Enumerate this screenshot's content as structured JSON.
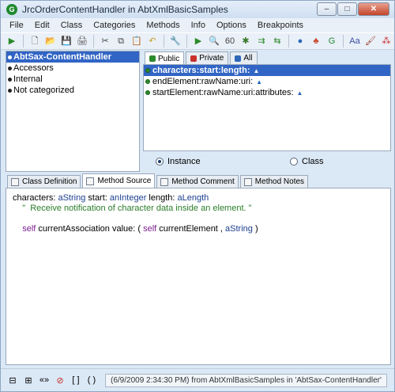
{
  "window": {
    "title": "JrcOrderContentHandler in AbtXmlBasicSamples",
    "app_icon_glyph": "G",
    "min_glyph": "–",
    "max_glyph": "□",
    "close_glyph": "✕"
  },
  "menu": [
    "File",
    "Edit",
    "Class",
    "Categories",
    "Methods",
    "Info",
    "Options",
    "Breakpoints"
  ],
  "toolbar": {
    "icons": [
      {
        "name": "run-icon",
        "glyph": "▶",
        "color": "#2a8a2a"
      },
      {
        "name": "new-icon",
        "glyph": "🗋",
        "color": "#444"
      },
      {
        "name": "open-icon",
        "glyph": "📂",
        "color": "#c89b2a"
      },
      {
        "name": "save-icon",
        "glyph": "💾",
        "color": "#3b5c8f"
      },
      {
        "name": "print-icon",
        "glyph": "🖨",
        "color": "#555"
      },
      {
        "name": "cut-icon",
        "glyph": "✂",
        "color": "#444"
      },
      {
        "name": "copy-icon",
        "glyph": "⧉",
        "color": "#444"
      },
      {
        "name": "paste-icon",
        "glyph": "📋",
        "color": "#a37b2c"
      },
      {
        "name": "undo-icon",
        "glyph": "↶",
        "color": "#c8a02a"
      },
      {
        "name": "tools-icon",
        "glyph": "🔧",
        "color": "#b35a2a"
      },
      {
        "name": "execute-icon",
        "glyph": "▶",
        "color": "#2a8a2a"
      },
      {
        "name": "inspect-icon",
        "glyph": "🔍",
        "color": "#444"
      },
      {
        "name": "display-icon",
        "glyph": "60",
        "color": "#444"
      },
      {
        "name": "debug-icon",
        "glyph": "✱",
        "color": "#3a7a2a"
      },
      {
        "name": "hierarchy-icon",
        "glyph": "⇉",
        "color": "#2a8a2a"
      },
      {
        "name": "references-icon",
        "glyph": "⇆",
        "color": "#2a8a2a"
      },
      {
        "name": "globe-icon",
        "glyph": "●",
        "color": "#2a6ab8"
      },
      {
        "name": "tree-icon",
        "glyph": "♣",
        "color": "#c8462a"
      },
      {
        "name": "refresh-icon",
        "glyph": "G",
        "color": "#1f8a2e"
      },
      {
        "name": "font-icon",
        "glyph": "Aa",
        "color": "#3a4fa0"
      },
      {
        "name": "paint-icon",
        "glyph": "🖌",
        "color": "#9a3a2a"
      },
      {
        "name": "group-icon",
        "glyph": "⁂",
        "color": "#c82a2a"
      }
    ]
  },
  "categories": [
    {
      "label": "AbtSax-ContentHandler",
      "selected": true
    },
    {
      "label": "Accessors",
      "selected": false
    },
    {
      "label": "Internal",
      "selected": false
    },
    {
      "label": "Not categorized",
      "selected": false
    }
  ],
  "visibility_tabs": [
    {
      "label": "Public",
      "active": true,
      "color": "#2c8a2c"
    },
    {
      "label": "Private",
      "active": false,
      "color": "#c8302a"
    },
    {
      "label": "All",
      "active": false,
      "color": "#2c66b8"
    }
  ],
  "methods": [
    {
      "label": "characters:start:length:",
      "selected": true
    },
    {
      "label": "endElement:rawName:uri:",
      "selected": false
    },
    {
      "label": "startElement:rawName:uri:attributes:",
      "selected": false
    }
  ],
  "side": {
    "instance_label": "Instance",
    "class_label": "Class",
    "selected": "instance"
  },
  "bottom_tabs": [
    {
      "label": "Class Definition",
      "active": false
    },
    {
      "label": "Method Source",
      "active": true
    },
    {
      "label": "Method Comment",
      "active": false
    },
    {
      "label": "Method Notes",
      "active": false
    }
  ],
  "source": {
    "line1": {
      "a": "characters: ",
      "b": "aString",
      "c": " start: ",
      "d": "anInteger",
      "e": " length: ",
      "f": "aLength"
    },
    "line2": "    \"  Receive notification of character data inside an element. \"",
    "line4": {
      "a": "self",
      "b": " currentAssociation value: ( ",
      "c": "self",
      "d": " currentElement , ",
      "e": "aString",
      "f": " )"
    }
  },
  "status": {
    "text": "(6/9/2009 2:34:30 PM) from AbtXmlBasicSamples in 'AbtSax-ContentHandler'",
    "icons": [
      {
        "name": "split-horizontal-icon",
        "glyph": "⊟"
      },
      {
        "name": "split-vertical-icon",
        "glyph": "⊞"
      },
      {
        "name": "more-icon",
        "glyph": "«»"
      },
      {
        "name": "stop-icon",
        "glyph": "⊘"
      },
      {
        "name": "brackets-icon",
        "glyph": "[ ]"
      },
      {
        "name": "parens-icon",
        "glyph": "( )"
      }
    ]
  }
}
